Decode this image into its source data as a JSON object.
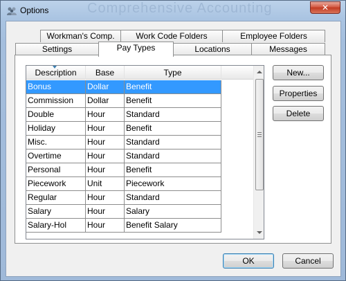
{
  "window": {
    "title": "Options",
    "close_glyph": "✕",
    "background_caption": "Comprehensive Accounting"
  },
  "tabs": {
    "row_top": [
      "Workman's Comp.",
      "Work Code Folders",
      "Employee Folders"
    ],
    "row_bottom": [
      "Settings",
      "Pay Types",
      "Locations",
      "Messages"
    ],
    "active": "Pay Types"
  },
  "grid": {
    "columns": [
      "Description",
      "Base",
      "Type"
    ],
    "rows": [
      [
        "Bonus",
        "Dollar",
        "Benefit"
      ],
      [
        "Commission",
        "Dollar",
        "Benefit"
      ],
      [
        "Double",
        "Hour",
        "Standard"
      ],
      [
        "Holiday",
        "Hour",
        "Benefit"
      ],
      [
        "Misc.",
        "Hour",
        "Standard"
      ],
      [
        "Overtime",
        "Hour",
        "Standard"
      ],
      [
        "Personal",
        "Hour",
        "Benefit"
      ],
      [
        "Piecework",
        "Unit",
        "Piecework"
      ],
      [
        "Regular",
        "Hour",
        "Standard"
      ],
      [
        "Salary",
        "Hour",
        "Salary"
      ],
      [
        "Salary-Hol",
        "Hour",
        "Benefit Salary"
      ]
    ],
    "selected_row": "Bonus"
  },
  "side_buttons": {
    "new_label": "New...",
    "properties_label": "Properties",
    "delete_label": "Delete"
  },
  "footer_buttons": {
    "ok_label": "OK",
    "cancel_label": "Cancel"
  },
  "colors": {
    "selection": "#3399ff",
    "accent_border": "#3c7fb1"
  },
  "icons": {
    "title": "people-group-icon",
    "close": "close-icon",
    "sort": "sort-indicator-icon"
  }
}
